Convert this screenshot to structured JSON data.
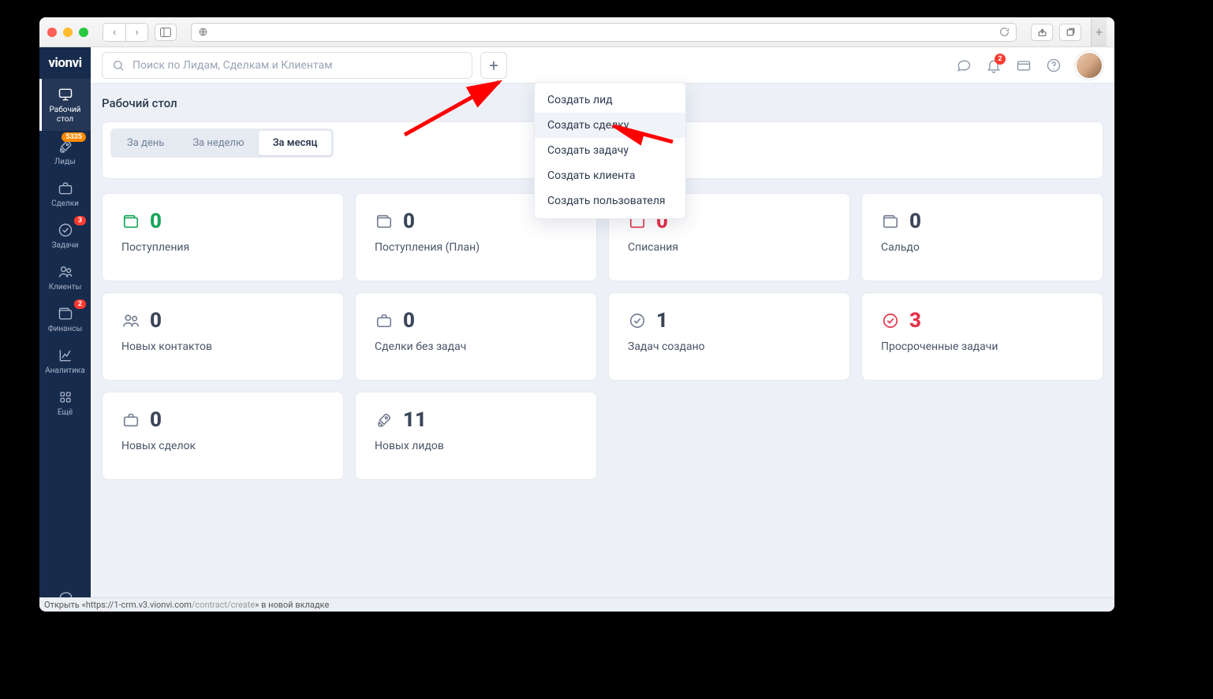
{
  "logo": "vionvi",
  "browser": {
    "status_prefix": "Открыть «",
    "status_url_a": "https://1-crm.v3.vionvi.com",
    "status_url_b": "/contract/create",
    "status_suffix": "» в новой вкладке"
  },
  "sidebar": {
    "items": [
      {
        "label": "Рабочий стол",
        "badge": "",
        "active": true
      },
      {
        "label": "Лиды",
        "badge": "5335",
        "badgeColor": "orange"
      },
      {
        "label": "Сделки",
        "badge": ""
      },
      {
        "label": "Задачи",
        "badge": "3",
        "badgeColor": "red"
      },
      {
        "label": "Клиенты",
        "badge": ""
      },
      {
        "label": "Финансы",
        "badge": "2",
        "badgeColor": "red"
      },
      {
        "label": "Аналитика",
        "badge": ""
      },
      {
        "label": "Ещё",
        "badge": ""
      }
    ]
  },
  "search": {
    "placeholder": "Поиск по Лидам, Сделкам и Клиентам"
  },
  "notifications": {
    "count": "2"
  },
  "dropdown": {
    "items": [
      "Создать лид",
      "Создать сделку",
      "Создать задачу",
      "Создать клиента",
      "Создать пользователя"
    ],
    "hover_index": 1
  },
  "page": {
    "title": "Рабочий стол",
    "tabs": [
      "За день",
      "За неделю",
      "За месяц"
    ],
    "active_tab": 2
  },
  "cards": [
    {
      "value": "0",
      "label": "Поступления",
      "color": "green",
      "icon": "wallet"
    },
    {
      "value": "0",
      "label": "Поступления (План)",
      "color": "grey",
      "icon": "wallet"
    },
    {
      "value": "0",
      "label": "Списания",
      "color": "red",
      "icon": "wallet"
    },
    {
      "value": "0",
      "label": "Сальдо",
      "color": "grey",
      "icon": "wallet"
    },
    {
      "value": "0",
      "label": "Новых контактов",
      "color": "grey",
      "icon": "users"
    },
    {
      "value": "0",
      "label": "Сделки без задач",
      "color": "grey",
      "icon": "briefcase"
    },
    {
      "value": "1",
      "label": "Задач создано",
      "color": "grey",
      "icon": "check"
    },
    {
      "value": "3",
      "label": "Просроченные задачи",
      "color": "red",
      "icon": "check"
    },
    {
      "value": "0",
      "label": "Новых сделок",
      "color": "grey",
      "icon": "briefcase"
    },
    {
      "value": "11",
      "label": "Новых лидов",
      "color": "grey",
      "icon": "rocket"
    }
  ]
}
